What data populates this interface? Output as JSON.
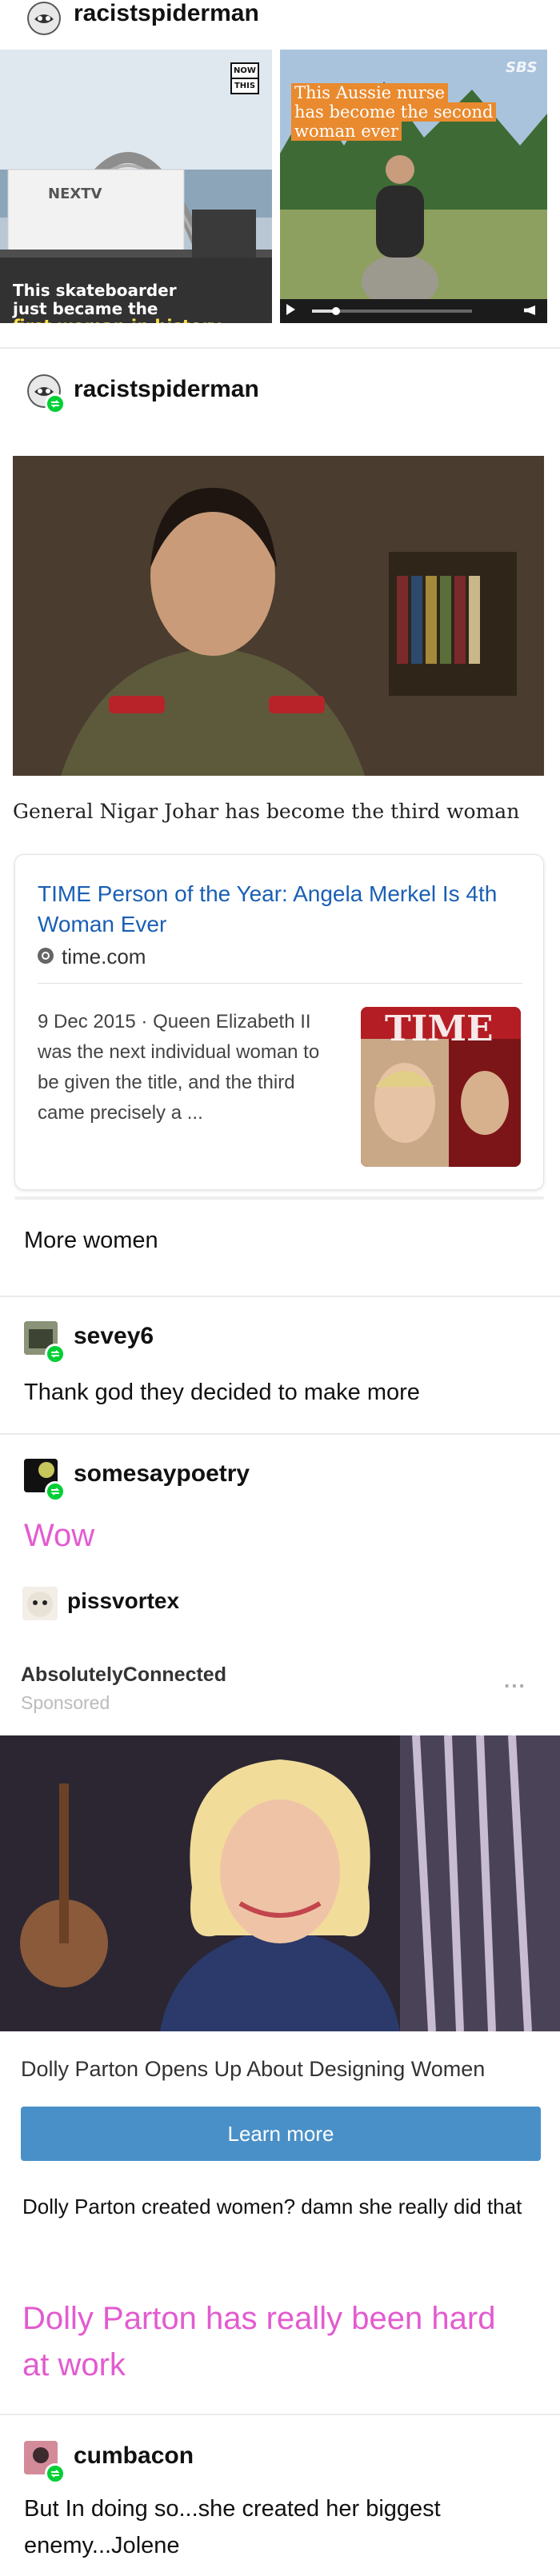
{
  "post1": {
    "username": "racistspiderman",
    "left_image": {
      "badge_line1": "NOW",
      "badge_line2": "THIS",
      "truck_logo": "NEXTV",
      "caption_line1": "This skateboarder",
      "caption_line2": "just became the",
      "caption_line3": "first woman in history"
    },
    "right_image": {
      "watermark": "SBS",
      "caption_line1": "This Aussie nurse",
      "caption_line2": "has become the second",
      "caption_line3": "woman ever"
    }
  },
  "post2": {
    "username": "racistspiderman",
    "photo_caption": "General Nigar Johar has become the third woman",
    "search_card": {
      "title": "TIME Person of the Year: Angela Merkel Is 4th Woman Ever",
      "domain": "time.com",
      "snippet": "9 Dec 2015 · Queen Elizabeth II was the next individual woman to be given the title, and the third came precisely a ...",
      "thumb_label": "TIME"
    },
    "text": "More women"
  },
  "post3": {
    "username": "sevey6",
    "text": "Thank god they decided to make more"
  },
  "post4": {
    "username": "somesaypoetry",
    "text": "Wow"
  },
  "post5": {
    "username": "pissvortex",
    "ad": {
      "advertiser": "AbsolutelyConnected",
      "sponsored": "Sponsored",
      "menu": "...",
      "headline": "Dolly Parton Opens Up About Designing Women",
      "cta": "Learn more"
    },
    "text": "Dolly Parton created women? damn she really did that",
    "pink_text": "Dolly Parton has really been hard at work"
  },
  "post6": {
    "username": "cumbacon",
    "text": "But In doing so...she created her biggest enemy...Jolene"
  },
  "colors": {
    "reblog_green": "#00cf35",
    "pink_text": "#e35bd0",
    "cta_blue": "#4a90c8",
    "link_blue": "#1a5fb4"
  },
  "icons": [
    "reblog-icon",
    "globe-icon",
    "more-icon",
    "play-icon",
    "volume-icon"
  ]
}
